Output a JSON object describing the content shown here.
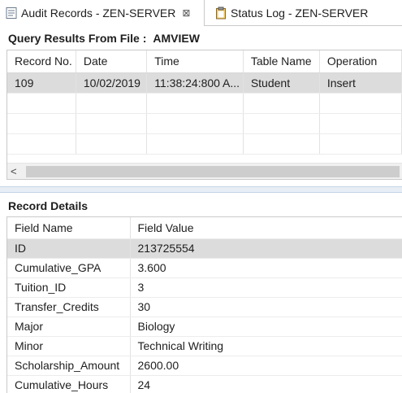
{
  "tabs": [
    {
      "label": "Audit Records - ZEN-SERVER",
      "icon": "audit-records-icon",
      "active": true
    },
    {
      "label": "Status Log - ZEN-SERVER",
      "icon": "clipboard-icon",
      "active": false
    }
  ],
  "query": {
    "title": "Query Results From File :",
    "file": "AMVIEW",
    "columns": [
      "Record No.",
      "Date",
      "Time",
      "Table Name",
      "Operation"
    ],
    "rows": [
      [
        "109",
        "10/02/2019",
        "11:38:24:800 A...",
        "Student",
        "Insert"
      ]
    ]
  },
  "details": {
    "title": "Record Details",
    "columns": [
      "Field Name",
      "Field Value"
    ],
    "rows": [
      [
        "ID",
        "213725554"
      ],
      [
        "Cumulative_GPA",
        "3.600"
      ],
      [
        "Tuition_ID",
        "3"
      ],
      [
        "Transfer_Credits",
        "30"
      ],
      [
        "Major",
        "Biology"
      ],
      [
        "Minor",
        "Technical Writing"
      ],
      [
        "Scholarship_Amount",
        "2600.00"
      ],
      [
        "Cumulative_Hours",
        "24"
      ]
    ]
  },
  "scroll": {
    "left_arrow": "<"
  },
  "close_glyph": "⊠"
}
